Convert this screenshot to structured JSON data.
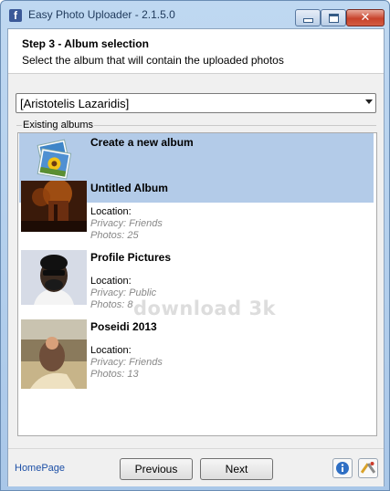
{
  "window": {
    "title": "Easy Photo Uploader - 2.1.5.0",
    "app_icon": "facebook-icon"
  },
  "header": {
    "step_title": "Step 3 - Album selection",
    "step_description": "Select the album that will contain the uploaded photos"
  },
  "account_select": {
    "selected": "[Aristotelis Lazaridis]"
  },
  "albums_group": {
    "label": "Existing albums",
    "items": [
      {
        "name": "Create a new album",
        "selected": true
      },
      {
        "name": "Untitled Album",
        "location": "Location:",
        "privacy": "Privacy: Friends",
        "photos": "Photos: 25"
      },
      {
        "name": "Profile Pictures",
        "location": "Location:",
        "privacy": "Privacy: Public",
        "photos": "Photos: 8"
      },
      {
        "name": "Poseidi 2013",
        "location": "Location:",
        "privacy": "Privacy: Friends",
        "photos": "Photos: 13"
      }
    ]
  },
  "watermark": "download 3k",
  "footer": {
    "homepage": "HomePage",
    "previous": "Previous",
    "next": "Next"
  },
  "colors": {
    "selection": "#b3cbe8",
    "link": "#1c4fa6",
    "meta_gray": "#888888"
  }
}
